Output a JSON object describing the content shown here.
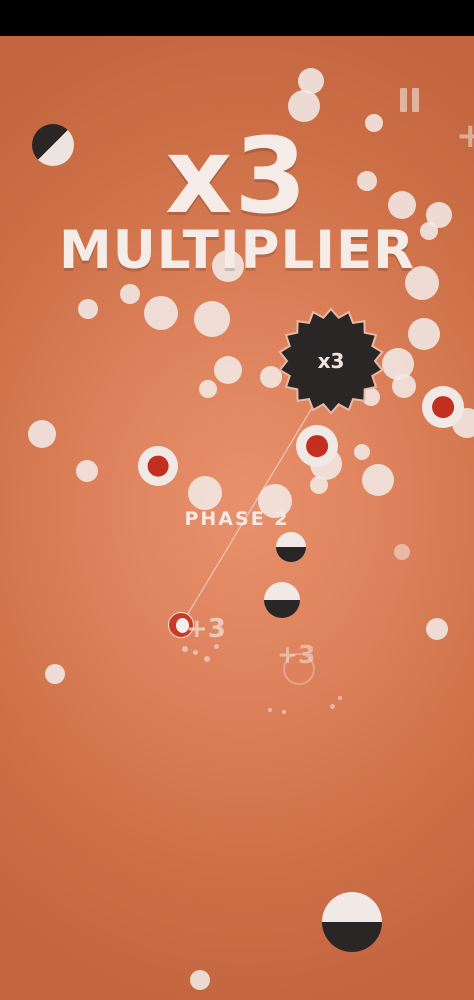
{
  "game": {
    "multiplier_value": "x3",
    "multiplier_label": "MULTIPLIER",
    "phase_label": "PHASE 2",
    "enemy_multiplier": "x3",
    "score_popups": [
      "+3",
      "+3"
    ],
    "edge_plus": "+",
    "pause_icon": "pause-icon"
  },
  "colors": {
    "background": "#dd825c",
    "text": "#f5ece8",
    "dot": "#f1e9e6",
    "target_core": "#c22f1e",
    "dark": "#2b2626"
  }
}
